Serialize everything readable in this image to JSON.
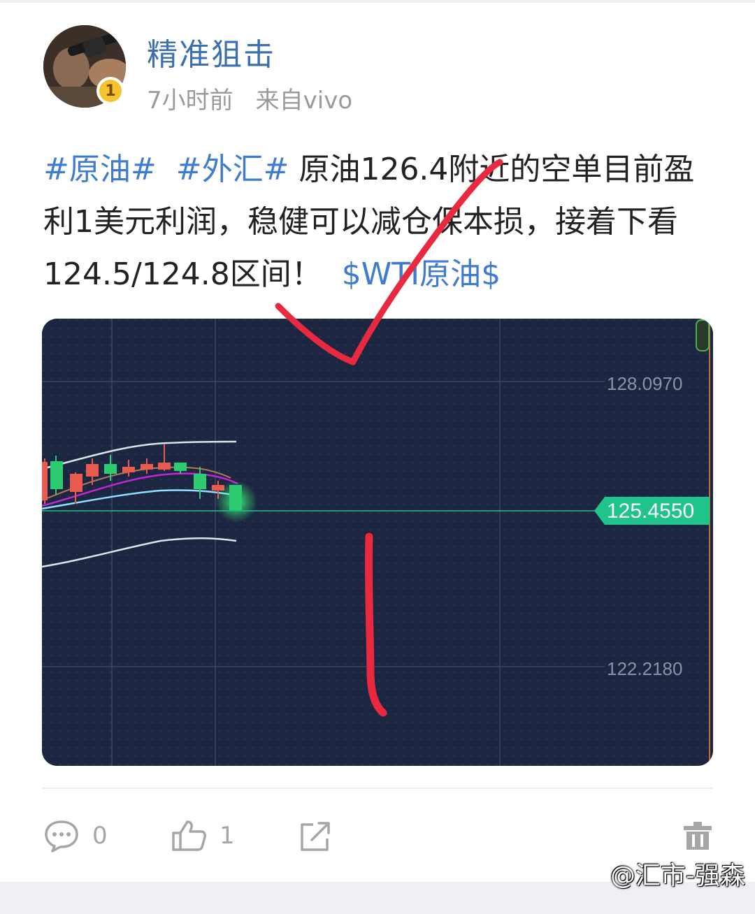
{
  "header": {
    "username": "精准狙击",
    "level_badge": "1",
    "time": "7小时前",
    "source": "来自vivo"
  },
  "post": {
    "tag1": "#原油#",
    "tag2": "#外汇#",
    "body": "原油126.4附近的空单目前盈利1美元利润，稳健可以减仓保本损，接着下看124.5/124.8区间！",
    "stock_tag": "$WTI原油$"
  },
  "chart": {
    "price_labels": {
      "top": "128.0970",
      "current": "125.4550",
      "bottom": "122.2180"
    },
    "colors": {
      "background": "#1c2640",
      "up": "#e95b4f",
      "down": "#2ecc71",
      "current_line": "#1fc48a",
      "annotation": "#e8293f"
    }
  },
  "actions": {
    "comment_count": "0",
    "like_count": "1"
  },
  "watermark": "@汇市-强森",
  "icons": [
    "comment-icon",
    "like-icon",
    "share-icon",
    "delete-icon"
  ]
}
